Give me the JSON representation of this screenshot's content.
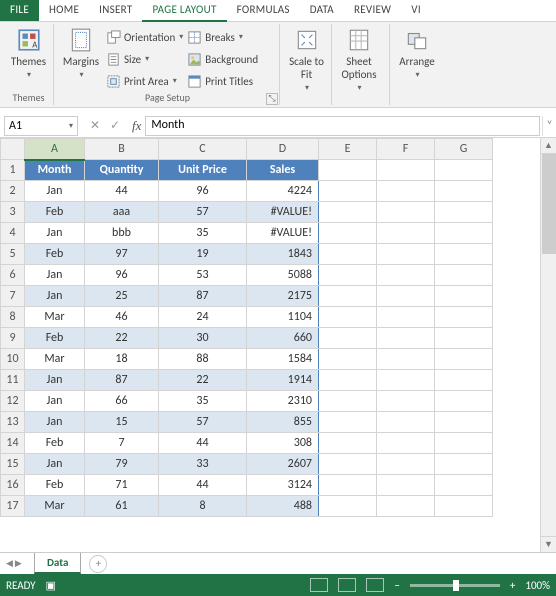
{
  "menubar": {
    "file": "FILE",
    "tabs": [
      "HOME",
      "INSERT",
      "PAGE LAYOUT",
      "FORMULAS",
      "DATA",
      "REVIEW",
      "VI"
    ],
    "active": "PAGE LAYOUT"
  },
  "ribbon": {
    "themes_group": {
      "themes": "Themes",
      "label": "Themes"
    },
    "page_setup": {
      "margins": "Margins",
      "orientation": "Orientation",
      "size": "Size",
      "print_area": "Print Area",
      "breaks": "Breaks",
      "background": "Background",
      "print_titles": "Print Titles",
      "label": "Page Setup"
    },
    "scale": {
      "scale_to_fit": "Scale to\nFit",
      "label": ""
    },
    "sheet_opts": {
      "sheet_options": "Sheet\nOptions",
      "label": ""
    },
    "arrange": {
      "arrange": "Arrange",
      "label": ""
    }
  },
  "formula_bar": {
    "name_box": "A1",
    "cancel": "✕",
    "enter": "✓",
    "fx": "fx",
    "formula": "Month"
  },
  "grid": {
    "columns": [
      "A",
      "B",
      "C",
      "D",
      "E",
      "F",
      "G"
    ],
    "selected_col": "A",
    "headers": [
      "Month",
      "Quantity",
      "Unit Price",
      "Sales"
    ],
    "rows": [
      {
        "n": 2,
        "c": [
          "Jan",
          "44",
          "96",
          "4224"
        ]
      },
      {
        "n": 3,
        "c": [
          "Feb",
          "aaa",
          "57",
          "#VALUE!"
        ]
      },
      {
        "n": 4,
        "c": [
          "Jan",
          "bbb",
          "35",
          "#VALUE!"
        ]
      },
      {
        "n": 5,
        "c": [
          "Feb",
          "97",
          "19",
          "1843"
        ]
      },
      {
        "n": 6,
        "c": [
          "Jan",
          "96",
          "53",
          "5088"
        ]
      },
      {
        "n": 7,
        "c": [
          "Jan",
          "25",
          "87",
          "2175"
        ]
      },
      {
        "n": 8,
        "c": [
          "Mar",
          "46",
          "24",
          "1104"
        ]
      },
      {
        "n": 9,
        "c": [
          "Feb",
          "22",
          "30",
          "660"
        ]
      },
      {
        "n": 10,
        "c": [
          "Mar",
          "18",
          "88",
          "1584"
        ]
      },
      {
        "n": 11,
        "c": [
          "Jan",
          "87",
          "22",
          "1914"
        ]
      },
      {
        "n": 12,
        "c": [
          "Jan",
          "66",
          "35",
          "2310"
        ]
      },
      {
        "n": 13,
        "c": [
          "Jan",
          "15",
          "57",
          "855"
        ]
      },
      {
        "n": 14,
        "c": [
          "Feb",
          "7",
          "44",
          "308"
        ]
      },
      {
        "n": 15,
        "c": [
          "Jan",
          "79",
          "33",
          "2607"
        ]
      },
      {
        "n": 16,
        "c": [
          "Feb",
          "71",
          "44",
          "3124"
        ]
      },
      {
        "n": 17,
        "c": [
          "Mar",
          "61",
          "8",
          "488"
        ]
      }
    ]
  },
  "sheet_tabs": {
    "active": "Data"
  },
  "status": {
    "ready": "READY",
    "zoom": "100%"
  },
  "chart_data": {
    "type": "table",
    "title": "",
    "columns": [
      "Month",
      "Quantity",
      "Unit Price",
      "Sales"
    ],
    "rows": [
      [
        "Jan",
        44,
        96,
        4224
      ],
      [
        "Feb",
        "aaa",
        57,
        "#VALUE!"
      ],
      [
        "Jan",
        "bbb",
        35,
        "#VALUE!"
      ],
      [
        "Feb",
        97,
        19,
        1843
      ],
      [
        "Jan",
        96,
        53,
        5088
      ],
      [
        "Jan",
        25,
        87,
        2175
      ],
      [
        "Mar",
        46,
        24,
        1104
      ],
      [
        "Feb",
        22,
        30,
        660
      ],
      [
        "Mar",
        18,
        88,
        1584
      ],
      [
        "Jan",
        87,
        22,
        1914
      ],
      [
        "Jan",
        66,
        35,
        2310
      ],
      [
        "Jan",
        15,
        57,
        855
      ],
      [
        "Feb",
        7,
        44,
        308
      ],
      [
        "Jan",
        79,
        33,
        2607
      ],
      [
        "Feb",
        71,
        44,
        3124
      ],
      [
        "Mar",
        61,
        8,
        488
      ]
    ]
  }
}
